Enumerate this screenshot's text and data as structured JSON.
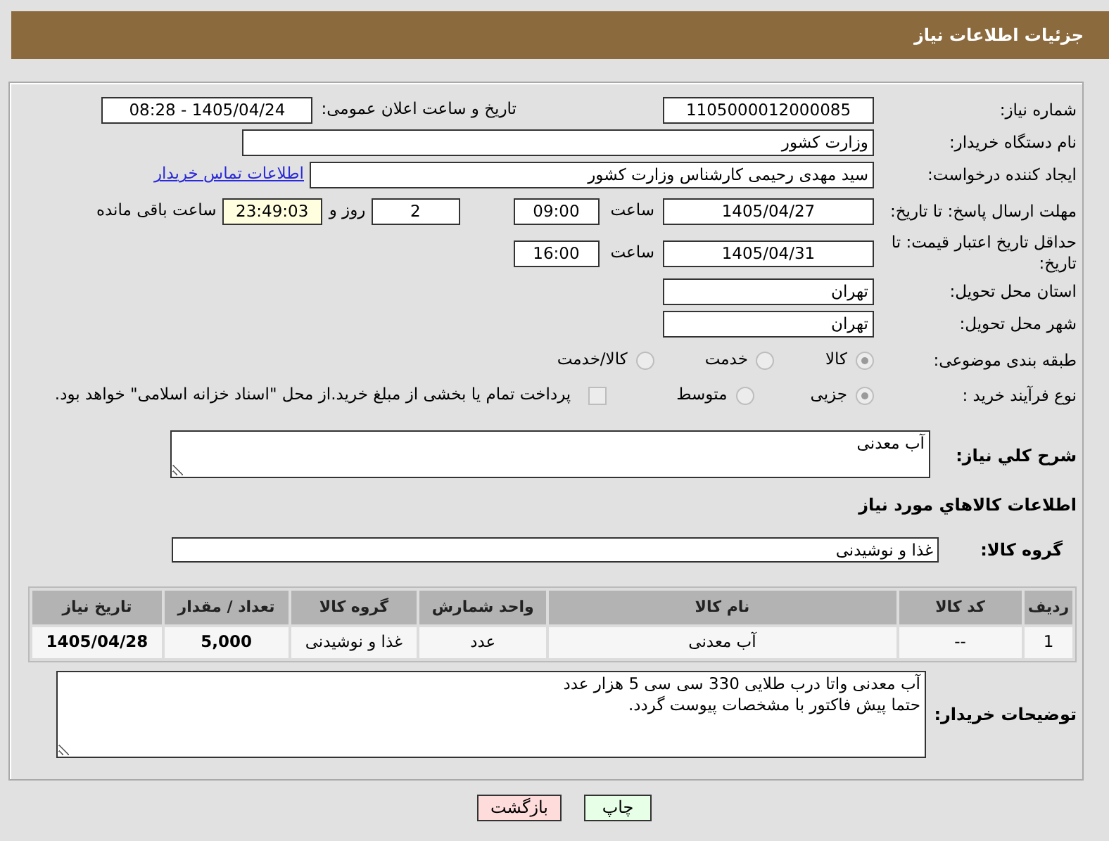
{
  "header": {
    "title": "جزئیات اطلاعات نیاز"
  },
  "need_number": {
    "label": "شماره نیاز:",
    "value": "1105000012000085"
  },
  "announce": {
    "label": "تاریخ و ساعت اعلان عمومی:",
    "value": "1405/04/24 - 08:28"
  },
  "buyer": {
    "label": "نام دستگاه خریدار:",
    "value": "وزارت کشور"
  },
  "requester": {
    "label": "ایجاد کننده درخواست:",
    "value": "سید مهدی رحیمی کارشناس وزارت کشور",
    "link": "اطلاعات تماس خریدار"
  },
  "deadline": {
    "label": "مهلت ارسال پاسخ: تا تاریخ:",
    "date": "1405/04/27",
    "time_label": "ساعت",
    "time": "09:00",
    "days": "2",
    "days_label": "روز و",
    "remaining": "23:49:03",
    "remaining_label": "ساعت باقی مانده"
  },
  "validity": {
    "label": "حداقل تاریخ اعتبار قیمت: تا تاریخ:",
    "date": "1405/04/31",
    "time_label": "ساعت",
    "time": "16:00"
  },
  "province": {
    "label": "استان محل تحویل:",
    "value": "تهران"
  },
  "city": {
    "label": "شهر محل تحویل:",
    "value": "تهران"
  },
  "category": {
    "label": "طبقه بندی موضوعی:",
    "options": [
      {
        "label": "کالا",
        "selected": true
      },
      {
        "label": "خدمت",
        "selected": false
      },
      {
        "label": "کالا/خدمت",
        "selected": false
      }
    ]
  },
  "process": {
    "label": "نوع فرآیند خرید :",
    "options": [
      {
        "label": "جزیی",
        "selected": true
      },
      {
        "label": "متوسط",
        "selected": false
      }
    ],
    "treasury": {
      "label": "پرداخت تمام یا بخشی از مبلغ خرید.از محل \"اسناد خزانه اسلامی\" خواهد بود.",
      "checked": false
    }
  },
  "description": {
    "label": "شرح کلي نیاز:",
    "value": "آب معدنی"
  },
  "goods_title": "اطلاعات کالاهاي مورد نیاز",
  "goods_group": {
    "label": "گروه کالا:",
    "value": "غذا و نوشیدنی"
  },
  "table": {
    "columns": [
      "ردیف",
      "کد کالا",
      "نام کالا",
      "واحد شمارش",
      "گروه کالا",
      "تعداد / مقدار",
      "تاریخ نیاز"
    ],
    "rows": [
      [
        "1",
        "--",
        "آب معدنی",
        "عدد",
        "غذا و نوشیدنی",
        "5,000",
        "1405/04/28"
      ]
    ]
  },
  "buyer_notes": {
    "label": "توضیحات خریدار:",
    "value": "آب معدنی واتا درب طلایی 330 سی سی 5 هزار عدد\nحتما پیش فاکتور با مشخصات پیوست گردد."
  },
  "buttons": [
    {
      "label": "چاپ",
      "kind": "print"
    },
    {
      "label": "بازگشت",
      "kind": "back"
    }
  ]
}
